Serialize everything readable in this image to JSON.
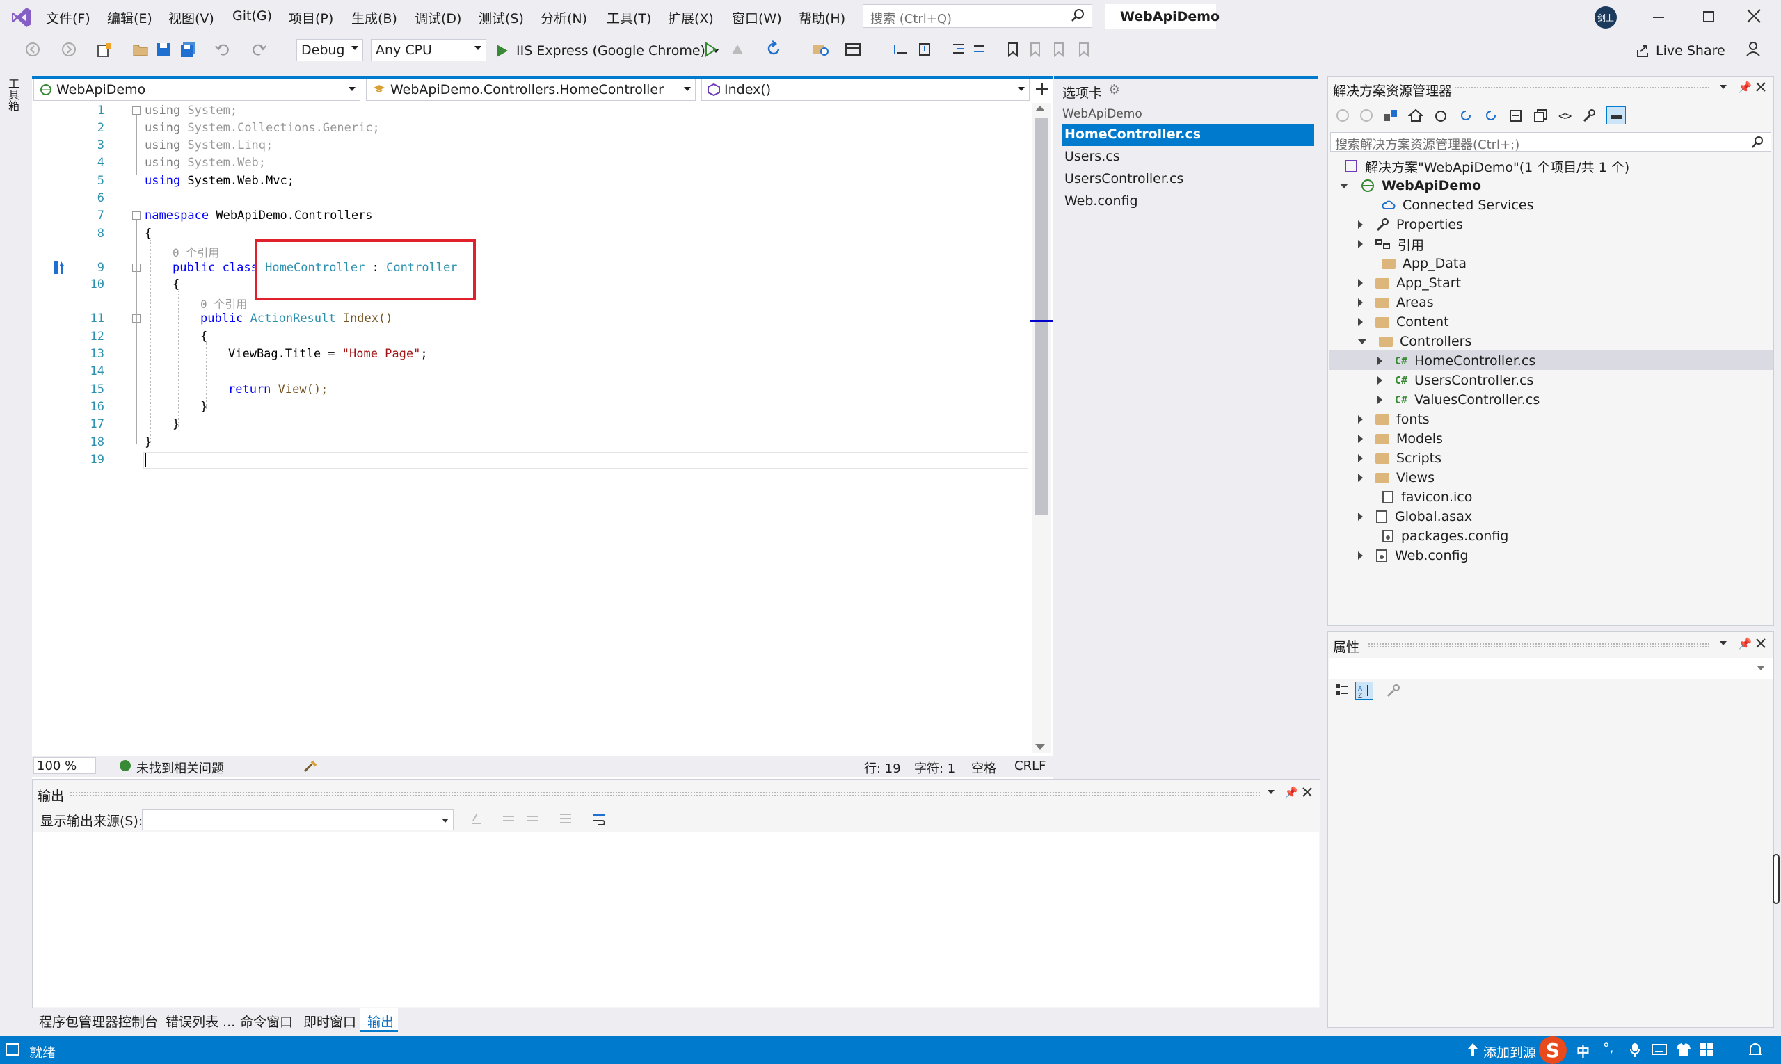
{
  "menubar": {
    "items": [
      "文件(F)",
      "编辑(E)",
      "视图(V)",
      "Git(G)",
      "项目(P)",
      "生成(B)",
      "调试(D)",
      "测试(S)",
      "分析(N)",
      "工具(T)",
      "扩展(X)",
      "窗口(W)",
      "帮助(H)"
    ],
    "search_placeholder": "搜索 (Ctrl+Q)",
    "solution_title": "WebApiDemo",
    "avatar_text": "剑上"
  },
  "toolbar": {
    "config": "Debug",
    "platform": "Any CPU",
    "run_label": "IIS Express (Google Chrome)",
    "live_share": "Live Share"
  },
  "left_strip": {
    "label": "工具箱"
  },
  "editor": {
    "nav_project": "WebApiDemo",
    "nav_class": "WebApiDemo.Controllers.HomeController",
    "nav_member": "Index()",
    "lines": [
      {
        "n": "1",
        "t": "using System;"
      },
      {
        "n": "2",
        "t": "using System.Collections.Generic;"
      },
      {
        "n": "3",
        "t": "using System.Linq;"
      },
      {
        "n": "4",
        "t": "using System.Web;"
      },
      {
        "n": "5",
        "t": "using System.Web.Mvc;"
      },
      {
        "n": "6",
        "t": ""
      },
      {
        "n": "7",
        "t": "namespace WebApiDemo.Controllers"
      },
      {
        "n": "8",
        "t": "{"
      },
      {
        "n": "9",
        "t": "public class HomeController : Controller"
      },
      {
        "n": "10",
        "t": "{"
      },
      {
        "n": "11",
        "t": "public ActionResult Index()"
      },
      {
        "n": "12",
        "t": "{"
      },
      {
        "n": "13",
        "t": "ViewBag.Title = \"Home Page\";"
      },
      {
        "n": "14",
        "t": ""
      },
      {
        "n": "15",
        "t": "return View();"
      },
      {
        "n": "16",
        "t": "}"
      },
      {
        "n": "17",
        "t": "}"
      },
      {
        "n": "18",
        "t": "}"
      },
      {
        "n": "19",
        "t": ""
      }
    ],
    "codelens_1": "0 个引用",
    "codelens_2": "0 个引用",
    "kw_using": "using",
    "kw_namespace": "namespace",
    "kw_public": "public",
    "kw_class": "class",
    "kw_return": "return",
    "ns_system": "System;",
    "ns_collections": "System.Collections.Generic;",
    "ns_linq": "System.Linq;",
    "ns_web": "System.Web;",
    "ns_mvc": "System.Web.Mvc;",
    "ns_name": "WebApiDemo.Controllers",
    "class_name": "HomeController",
    "colon": ":",
    "base_class": "Controller",
    "return_type": "ActionResult",
    "method_name": "Index()",
    "viewbag": "ViewBag.Title = ",
    "string_val": "\"Home Page\"",
    "semicolon": ";",
    "view_call": "View();",
    "zoom": "100 %",
    "issues": "未找到相关问题",
    "row": "行: 19",
    "col": "字符: 1",
    "indent": "空格",
    "eol": "CRLF"
  },
  "tabs_panel": {
    "title": "选项卡",
    "group": "WebApiDemo",
    "items": [
      "HomeController.cs",
      "Users.cs",
      "UsersController.cs",
      "Web.config"
    ]
  },
  "solution_explorer": {
    "title": "解决方案资源管理器",
    "search_placeholder": "搜索解决方案资源管理器(Ctrl+;)",
    "solution": "解决方案\"WebApiDemo\"(1 个项目/共 1 个)",
    "project": "WebApiDemo",
    "items": [
      "Connected Services",
      "Properties",
      "引用",
      "App_Data",
      "App_Start",
      "Areas",
      "Content",
      "Controllers",
      "HomeController.cs",
      "UsersController.cs",
      "ValuesController.cs",
      "fonts",
      "Models",
      "Scripts",
      "Views",
      "favicon.ico",
      "Global.asax",
      "packages.config",
      "Web.config"
    ],
    "cs_badge": "C#"
  },
  "properties": {
    "title": "属性"
  },
  "output": {
    "title": "输出",
    "source_label": "显示输出来源(S):",
    "tabs": [
      "程序包管理器控制台",
      "错误列表 ...",
      "命令窗口",
      "即时窗口",
      "输出"
    ]
  },
  "statusbar": {
    "ready": "就绪",
    "add_source": "添加到源",
    "ime": "中"
  }
}
